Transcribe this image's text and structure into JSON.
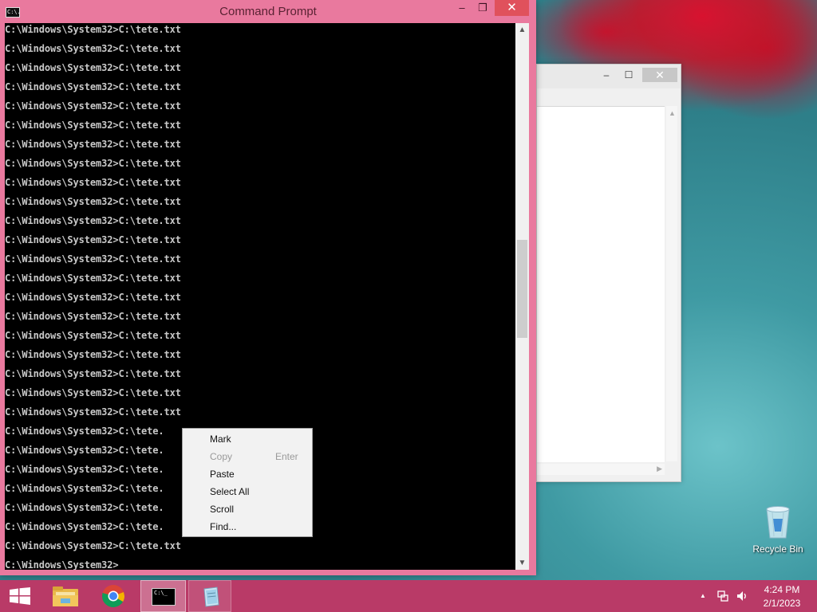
{
  "window": {
    "title": "Command Prompt",
    "icon_text": "C:\\.",
    "minimize_glyph": "–",
    "maximize_glyph": "❐",
    "close_glyph": "✕"
  },
  "console": {
    "lines": [
      "C:\\Windows\\System32>C:\\tete.txt",
      "C:\\Windows\\System32>C:\\tete.txt",
      "C:\\Windows\\System32>C:\\tete.txt",
      "C:\\Windows\\System32>C:\\tete.txt",
      "C:\\Windows\\System32>C:\\tete.txt",
      "C:\\Windows\\System32>C:\\tete.txt",
      "C:\\Windows\\System32>C:\\tete.txt",
      "C:\\Windows\\System32>C:\\tete.txt",
      "C:\\Windows\\System32>C:\\tete.txt",
      "C:\\Windows\\System32>C:\\tete.txt",
      "C:\\Windows\\System32>C:\\tete.txt",
      "C:\\Windows\\System32>C:\\tete.txt",
      "C:\\Windows\\System32>C:\\tete.txt",
      "C:\\Windows\\System32>C:\\tete.txt",
      "C:\\Windows\\System32>C:\\tete.txt",
      "C:\\Windows\\System32>C:\\tete.txt",
      "C:\\Windows\\System32>C:\\tete.txt",
      "C:\\Windows\\System32>C:\\tete.txt",
      "C:\\Windows\\System32>C:\\tete.txt",
      "C:\\Windows\\System32>C:\\tete.txt",
      "C:\\Windows\\System32>C:\\tete.txt",
      "C:\\Windows\\System32>C:\\tete.",
      "C:\\Windows\\System32>C:\\tete.",
      "C:\\Windows\\System32>C:\\tete.",
      "C:\\Windows\\System32>C:\\tete.",
      "C:\\Windows\\System32>C:\\tete.",
      "C:\\Windows\\System32>C:\\tete.",
      "C:\\Windows\\System32>C:\\tete.txt",
      "C:\\Windows\\System32>"
    ]
  },
  "context_menu": {
    "items": [
      {
        "label": "Mark",
        "shortcut": "",
        "enabled": true
      },
      {
        "label": "Copy",
        "shortcut": "Enter",
        "enabled": false
      },
      {
        "label": "Paste",
        "shortcut": "",
        "enabled": true
      },
      {
        "label": "Select All",
        "shortcut": "",
        "enabled": true
      },
      {
        "label": "Scroll",
        "shortcut": "",
        "enabled": true
      },
      {
        "label": "Find...",
        "shortcut": "",
        "enabled": true
      }
    ]
  },
  "background_window": {
    "minimize_glyph": "–",
    "maximize_glyph": "☐",
    "close_glyph": "✕"
  },
  "desktop": {
    "recycle_bin_label": "Recycle Bin"
  },
  "taskbar": {
    "cmd_icon_text": "C:\\_",
    "tray_overflow_glyph": "▲",
    "clock_time": "4:24 PM",
    "clock_date": "2/1/2023"
  },
  "colors": {
    "titlebar": "#e9799e",
    "taskbar": "#b93a67",
    "console_bg": "#000000",
    "console_text": "#c8c8c8"
  }
}
